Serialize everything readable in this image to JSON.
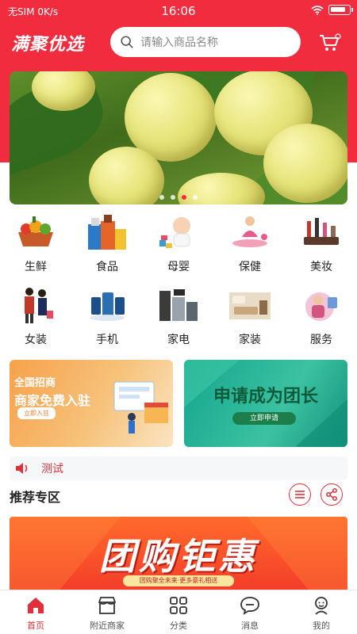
{
  "status_bar": {
    "carrier": "无SIM 0K/s",
    "time": "16:06"
  },
  "header": {
    "brand": "满聚优选",
    "search_placeholder": "请输入商品名称"
  },
  "banner": {
    "dot_count": 4,
    "active_dot": 2
  },
  "categories": [
    {
      "label": "生鲜",
      "icon": "fresh-produce-icon"
    },
    {
      "label": "食品",
      "icon": "food-icon"
    },
    {
      "label": "母婴",
      "icon": "baby-icon"
    },
    {
      "label": "保健",
      "icon": "health-icon"
    },
    {
      "label": "美妆",
      "icon": "cosmetics-icon"
    },
    {
      "label": "女装",
      "icon": "womens-clothing-icon"
    },
    {
      "label": "手机",
      "icon": "phone-icon"
    },
    {
      "label": "家电",
      "icon": "appliance-icon"
    },
    {
      "label": "家装",
      "icon": "home-decor-icon"
    },
    {
      "label": "服务",
      "icon": "service-icon"
    }
  ],
  "promos": {
    "left": {
      "title": "全国招商",
      "subtitle": "商家免费入驻",
      "button": "立即入驻"
    },
    "right": {
      "title": "申请成为团长",
      "button": "立即申请"
    }
  },
  "notice": {
    "text": "测试"
  },
  "section": {
    "title": "推荐专区"
  },
  "rec_banner": {
    "title": "团购钜惠",
    "tag": "团购聚全未来·更多豪礼相送"
  },
  "tabs": [
    {
      "label": "首页",
      "icon": "home-icon",
      "active": true
    },
    {
      "label": "附近商家",
      "icon": "store-icon",
      "active": false
    },
    {
      "label": "分类",
      "icon": "grid-icon",
      "active": false
    },
    {
      "label": "消息",
      "icon": "message-icon",
      "active": false
    },
    {
      "label": "我的",
      "icon": "profile-icon",
      "active": false
    }
  ],
  "colors": {
    "brand_red": "#f12c3e",
    "accent_red": "#e2303a",
    "notice_bg": "#f6f7f9"
  }
}
